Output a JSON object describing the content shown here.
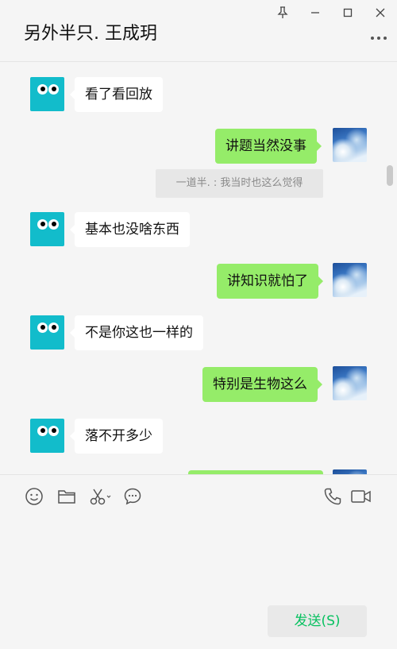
{
  "header": {
    "title": "另外半只. 王成玥"
  },
  "messages": [
    {
      "side": "left",
      "text": "看了看回放"
    },
    {
      "side": "right",
      "text": "讲题当然没事"
    },
    {
      "side": "quote",
      "text": "一道半. : 我当时也这么觉得"
    },
    {
      "side": "left",
      "text": "基本也没啥东西"
    },
    {
      "side": "right",
      "text": "讲知识就怕了"
    },
    {
      "side": "left",
      "text": "不是你这也一样的"
    },
    {
      "side": "right",
      "text": "特别是生物这么"
    },
    {
      "side": "left",
      "text": "落不开多少"
    },
    {
      "side": "right",
      "text": ""
    }
  ],
  "toolbar": {
    "icons": [
      "emoji-icon",
      "folder-icon",
      "scissors-icon",
      "chat-bubble-icon",
      "phone-icon",
      "video-icon"
    ]
  },
  "input": {
    "value": "",
    "placeholder": ""
  },
  "send_button": {
    "label": "发送(S)"
  },
  "colors": {
    "background": "#f5f5f5",
    "bubble_right": "#95ec69",
    "bubble_left": "#ffffff",
    "avatar_left": "#12bccb",
    "send_text": "#07c160"
  }
}
